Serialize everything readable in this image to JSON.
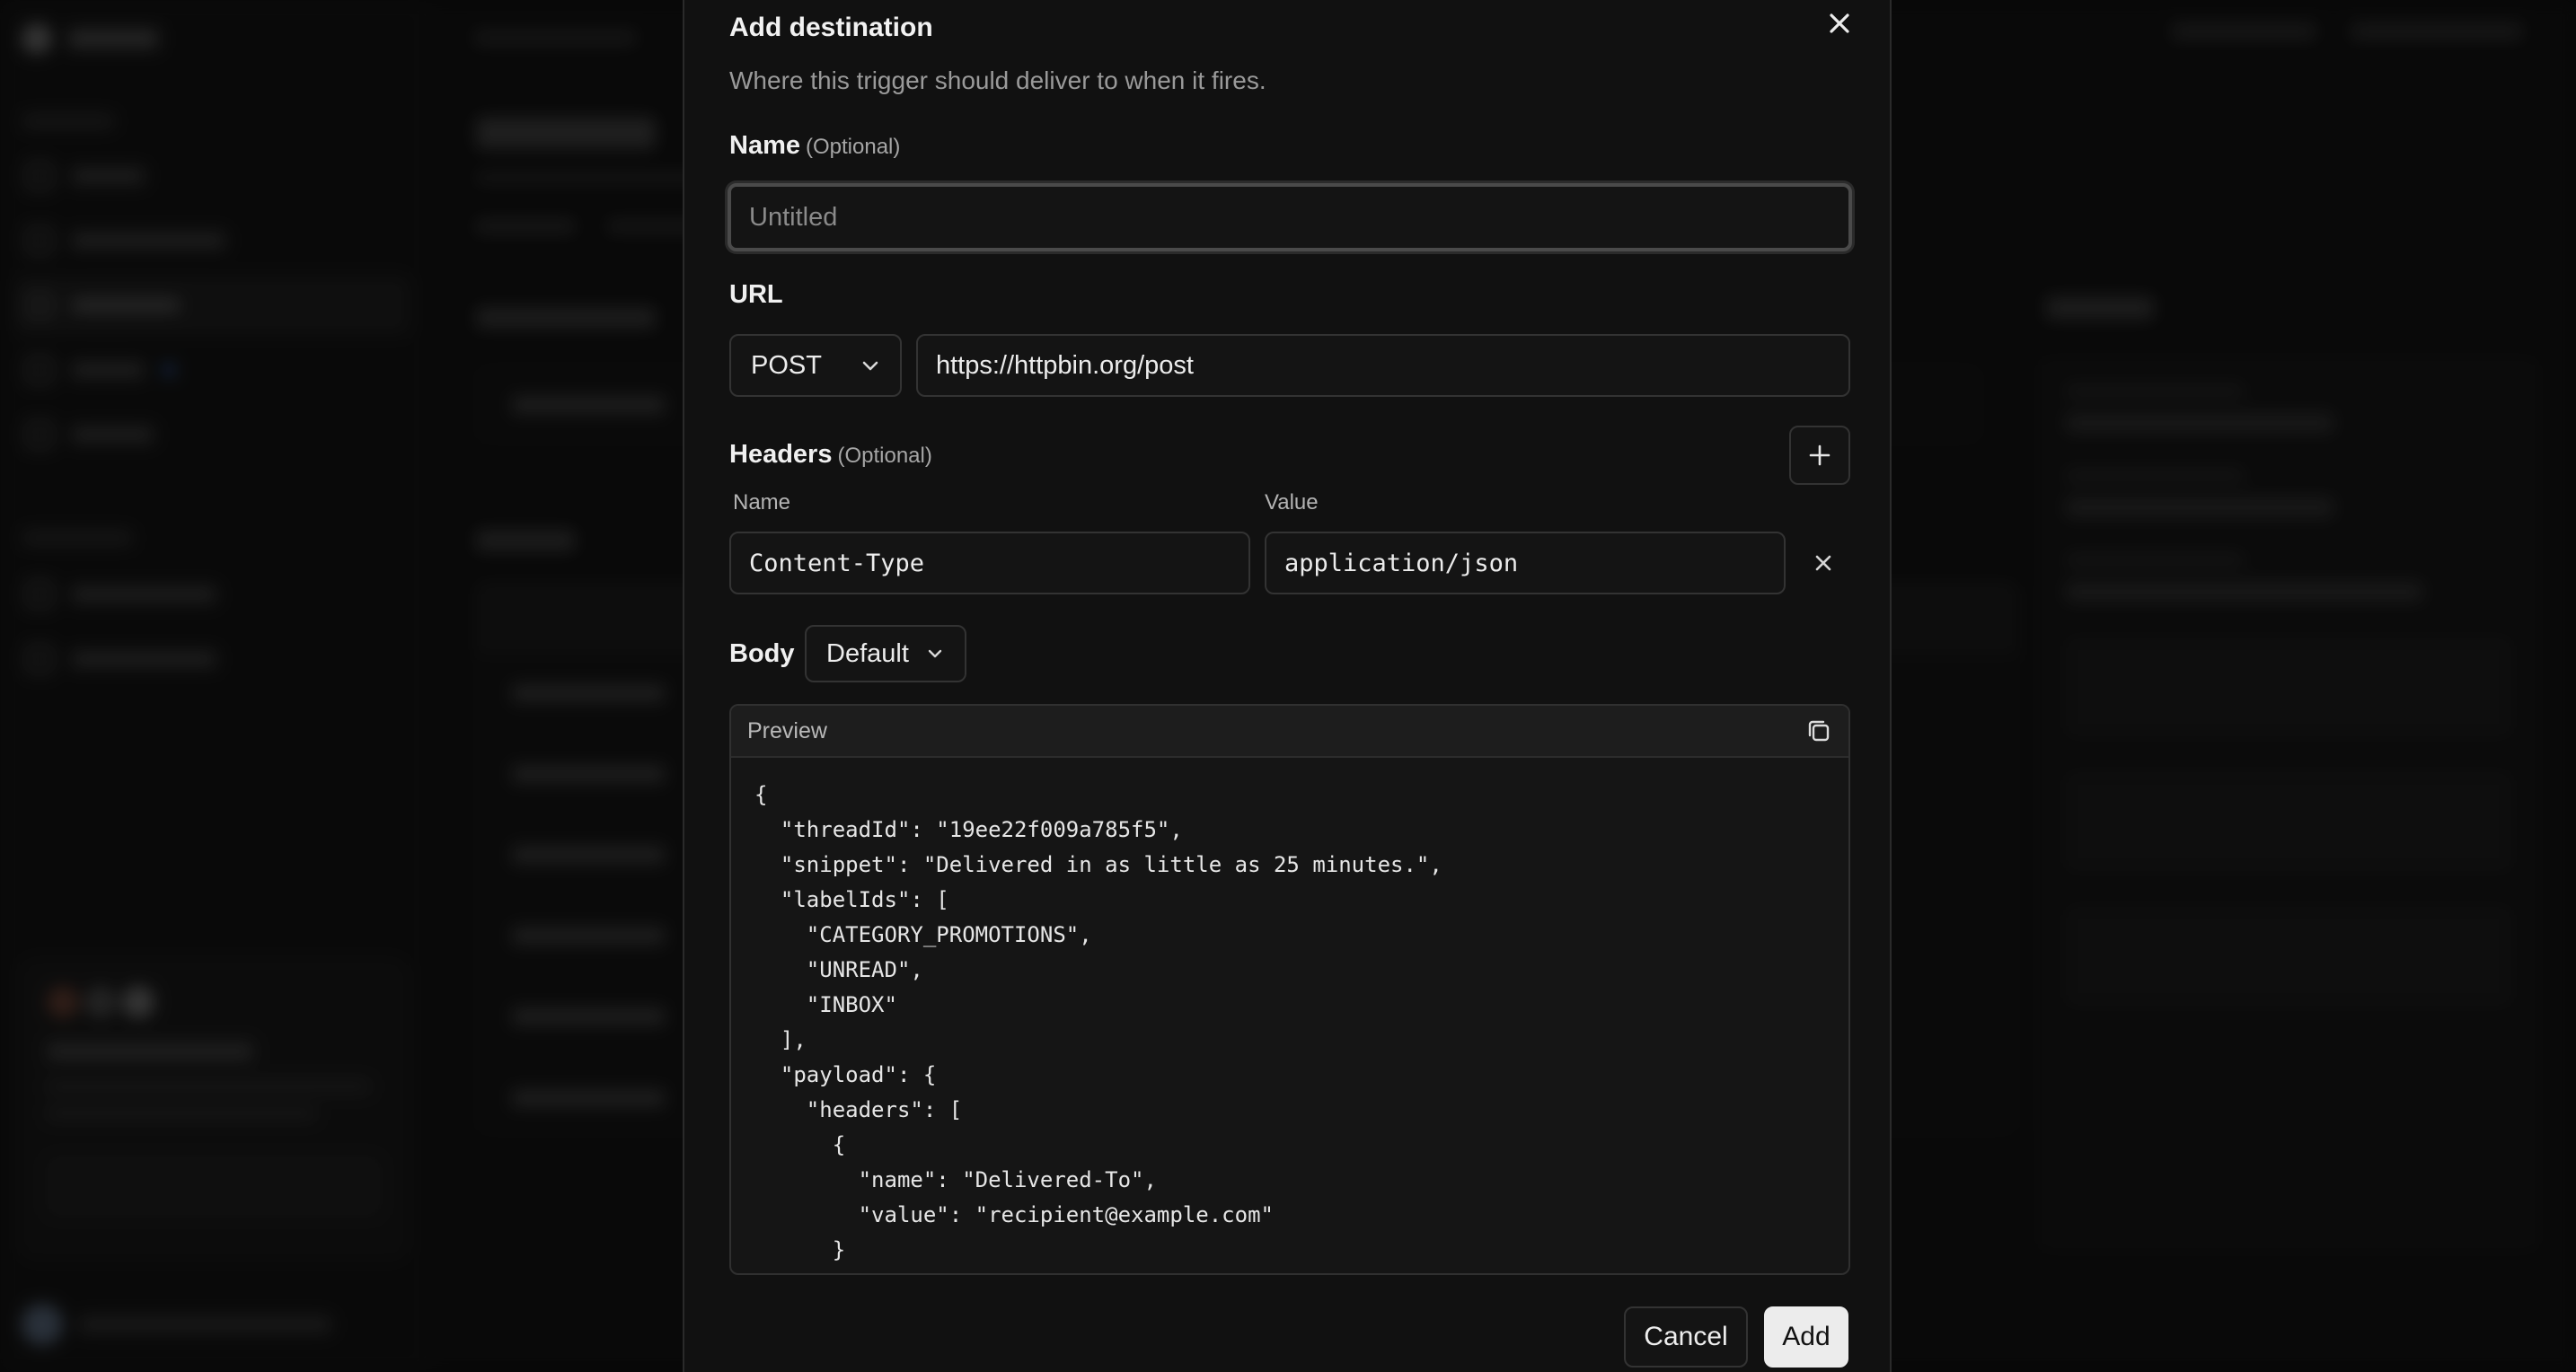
{
  "modal": {
    "title": "Add destination",
    "description": "Where this trigger should deliver to when it fires.",
    "name_label": "Name",
    "name_optional": "(Optional)",
    "name_placeholder": "Untitled",
    "url_label": "URL",
    "method": "POST",
    "url_value": "https://httpbin.org/post",
    "headers_label": "Headers",
    "headers_optional": "(Optional)",
    "header_name_col": "Name",
    "header_value_col": "Value",
    "headers": [
      {
        "name": "Content-Type",
        "value": "application/json"
      }
    ],
    "body_label": "Body",
    "body_mode": "Default",
    "preview_label": "Preview",
    "preview_lines": [
      "{",
      "  \"threadId\": \"19ee22f009a785f5\",",
      "  \"snippet\": \"Delivered in as little as 25 minutes.\",",
      "  \"labelIds\": [",
      "    \"CATEGORY_PROMOTIONS\",",
      "    \"UNREAD\",",
      "    \"INBOX\"",
      "  ],",
      "  \"payload\": {",
      "    \"headers\": [",
      "      {",
      "        \"name\": \"Delivered-To\",",
      "        \"value\": \"recipient@example.com\"",
      "      }",
      "    ],"
    ],
    "cancel_label": "Cancel",
    "add_label": "Add"
  },
  "icons": {
    "close": "close-icon",
    "chevron": "chevron-down-icon",
    "add": "plus-icon",
    "remove": "x-icon",
    "copy": "copy-icon"
  }
}
